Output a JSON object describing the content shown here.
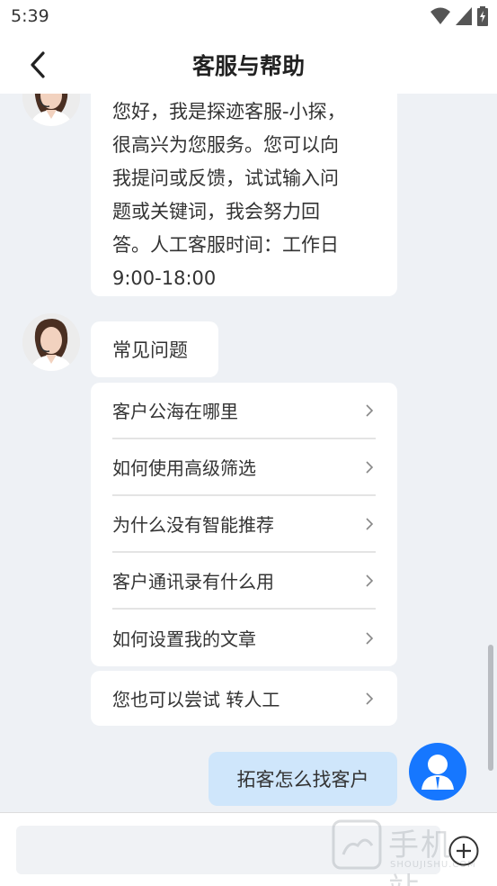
{
  "status_bar": {
    "time": "5:39",
    "icons": [
      "wifi-icon",
      "signal-icon",
      "battery-charging-icon"
    ]
  },
  "app_bar": {
    "title": "客服与帮助",
    "back_icon": "chevron-left-icon"
  },
  "chat": {
    "greeting": {
      "text": "您好，我是探迹客服-小探，\n很高兴为您服务。您可以向\n我提问或反馈，试试输入问\n题或关键词，我会努力回\n答。人工客服时间：工作日\n9:00-18:00"
    },
    "faq": {
      "heading": "常见问题",
      "items": [
        {
          "label": "客户公海在哪里"
        },
        {
          "label": "如何使用高级筛选"
        },
        {
          "label": "为什么没有智能推荐"
        },
        {
          "label": "客户通讯录有什么用"
        },
        {
          "label": "如何设置我的文章"
        }
      ]
    },
    "transfer": {
      "label": "您也可以尝试 转人工"
    },
    "user_message": {
      "text": "拓客怎么找客户"
    }
  },
  "input_bar": {
    "placeholder": "",
    "add_icon": "plus-circle-icon"
  },
  "watermark": {
    "main": "手机站",
    "sub": "SHOUJISHU.COM"
  },
  "colors": {
    "background": "#eef1f5",
    "user_bubble": "#cfe6fb",
    "user_avatar": "#1677ff"
  }
}
